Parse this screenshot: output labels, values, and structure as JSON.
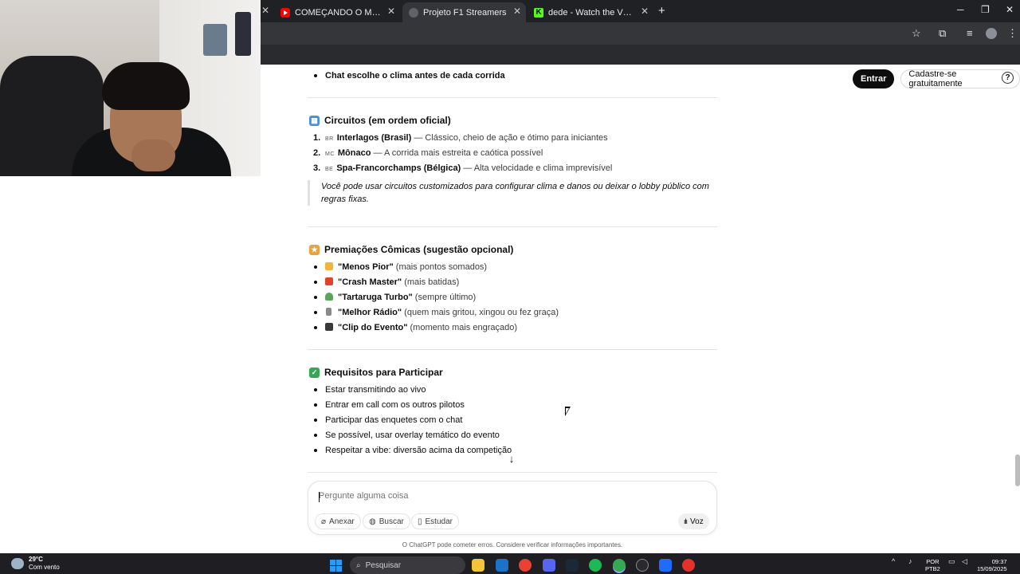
{
  "browser": {
    "tabs": [
      {
        "title": "COMEÇANDO O MODO CARRE",
        "favicon": "youtube-icon"
      },
      {
        "title": "Projeto F1 Streamers",
        "favicon": "chatgpt-icon",
        "active": true
      },
      {
        "title": "dede - Watch the VOD on Kick",
        "favicon": "kick-icon"
      }
    ]
  },
  "header": {
    "login_label": "Entrar",
    "signup_label": "Cadastre-se gratuitamente",
    "help_label": "?"
  },
  "content": {
    "top_bullet": "Chat escolhe o clima antes de cada corrida",
    "circuits": {
      "heading": "Circuitos (em ordem oficial)",
      "items": [
        {
          "num": "1.",
          "flag": "BR",
          "name": "Interlagos (Brasil)",
          "desc": " — Clássico, cheio de ação e ótimo para iniciantes"
        },
        {
          "num": "2.",
          "flag": "MC",
          "name": "Mônaco",
          "desc": " — A corrida mais estreita e caótica possível"
        },
        {
          "num": "3.",
          "flag": "BE",
          "name": "Spa-Francorchamps (Bélgica)",
          "desc": " — Alta velocidade e clima imprevisível"
        }
      ],
      "quote": "Você pode usar circuitos customizados para configurar clima e danos ou deixar o lobby público com regras fixas."
    },
    "awards": {
      "heading": "Premiações Cômicas (sugestão opcional)",
      "items": [
        {
          "name": "\"Menos Pior\"",
          "desc": " (mais pontos somados)"
        },
        {
          "name": "\"Crash Master\"",
          "desc": " (mais batidas)"
        },
        {
          "name": "\"Tartaruga Turbo\"",
          "desc": " (sempre último)"
        },
        {
          "name": "\"Melhor Rádio\"",
          "desc": " (quem mais gritou, xingou ou fez graça)"
        },
        {
          "name": "\"Clip do Evento\"",
          "desc": " (momento mais engraçado)"
        }
      ]
    },
    "requirements": {
      "heading": "Requisitos para Participar",
      "items": [
        "Estar transmitindo ao vivo",
        "Entrar em call com os outros pilotos",
        "Participar das enquetes com o chat",
        "Se possível, usar overlay temático do evento",
        "Respeitar a vibe: diversão acima da competição"
      ]
    }
  },
  "composer": {
    "placeholder": "Pergunte alguma coisa",
    "attach_label": "Anexar",
    "search_label": "Buscar",
    "study_label": "Estudar",
    "voice_label": "Voz",
    "disclaimer": "O ChatGPT pode cometer erros. Considere verificar informações importantes."
  },
  "taskbar": {
    "weather_temp": "29°C",
    "weather_desc": "Com vento",
    "search_label": "Pesquisar",
    "lang_line1": "POR",
    "lang_line2": "PTB2",
    "time": "09:37",
    "date": "15/09/2025"
  }
}
